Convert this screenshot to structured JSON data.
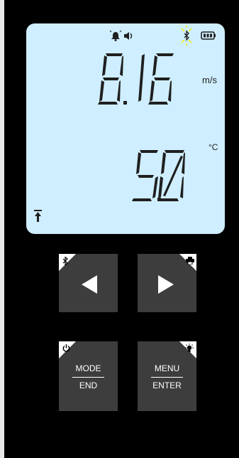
{
  "display": {
    "top_value": "8.16",
    "top_unit": "m/s",
    "bottom_value": "5.0",
    "bottom_unit": "°C",
    "background_color": "#cfeeff",
    "segment_color": "#1f1f1f"
  },
  "status_icons": [
    "alarm-bell-icon",
    "speaker-icon",
    "bluetooth-icon",
    "battery-icon",
    "hold-up-arrow-icon"
  ],
  "buttons": {
    "left": {
      "icon": "bluetooth-icon",
      "glyph": "left-arrow-icon"
    },
    "right": {
      "icon": "printer-icon",
      "glyph": "right-arrow-icon"
    },
    "mode": {
      "icon": "power-icon",
      "top": "MODE",
      "bottom": "END"
    },
    "menu": {
      "icon": "backlight-bulb-icon",
      "top": "MENU",
      "bottom": "ENTER"
    }
  },
  "colors": {
    "button_bg": "#3d3d3d",
    "bluetooth_glow": "#f5f000"
  }
}
